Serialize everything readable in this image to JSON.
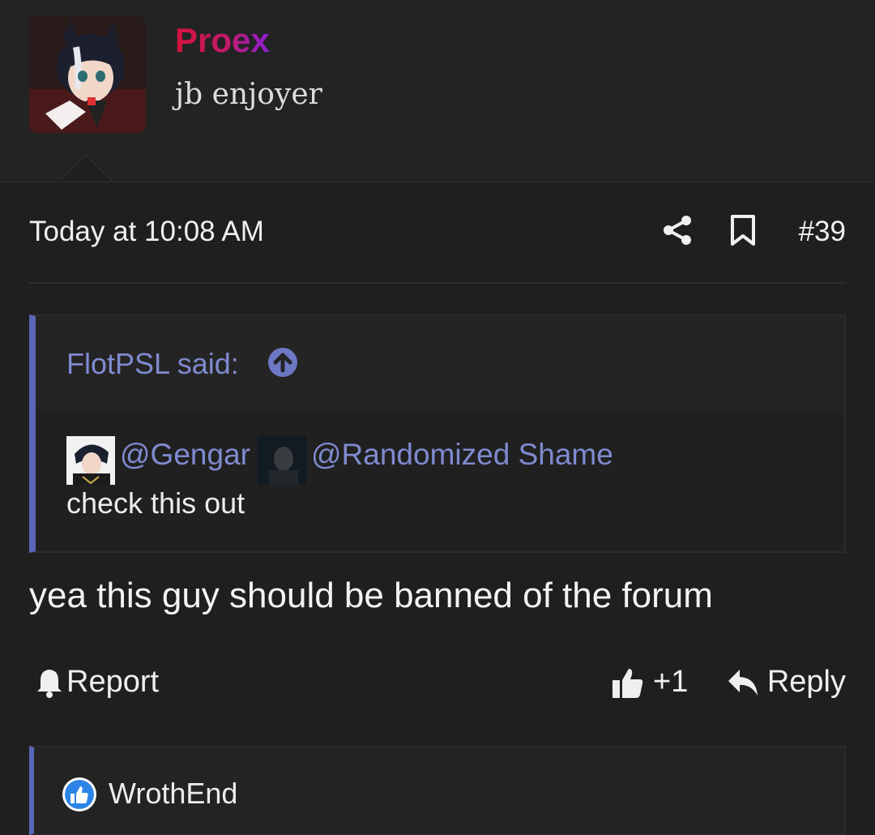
{
  "author": {
    "username": "Proex",
    "title": "jb enjoyer"
  },
  "post": {
    "date": "Today at 10:08 AM",
    "number": "#39",
    "text": "yea this guy should be banned of the forum"
  },
  "quote": {
    "author_label": "FlotPSL said:",
    "mentions": [
      "@Gengar",
      "@Randomized Shame"
    ],
    "text": "check this out"
  },
  "actions": {
    "report": "Report",
    "like_count": "+1",
    "reply": "Reply"
  },
  "reactions": {
    "user": "WrothEnd"
  },
  "colors": {
    "background": "#1f1f1f",
    "accent": "#7f8ad0",
    "quote_bar": "#5a66b8",
    "username_gradient": [
      "#d4123b",
      "#8b1fd6"
    ]
  },
  "icons": [
    "share-icon",
    "bookmark-icon",
    "arrow-up-circle-icon",
    "bell-icon",
    "thumbs-up-icon",
    "reply-arrow-icon",
    "like-badge-icon"
  ]
}
